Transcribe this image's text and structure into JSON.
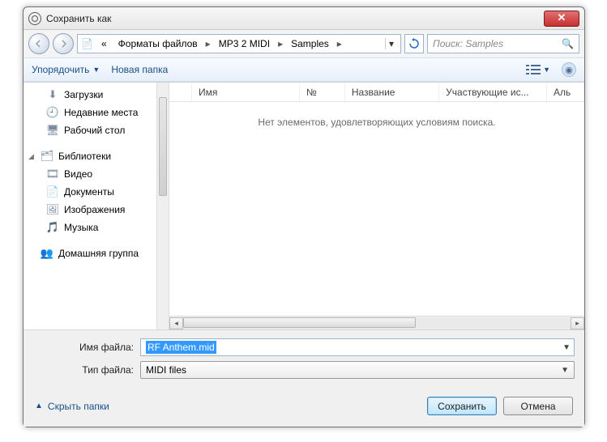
{
  "title": "Сохранить как",
  "close_glyph": "✕",
  "breadcrumb": {
    "prefix": "«",
    "segments": [
      "Форматы файлов",
      "MP3 2 MIDI",
      "Samples"
    ]
  },
  "search": {
    "placeholder": "Поиск: Samples"
  },
  "toolbar": {
    "organize": "Упорядочить",
    "new_folder": "Новая папка"
  },
  "sidebar": {
    "favorites": {
      "items": [
        "Загрузки",
        "Недавние места",
        "Рабочий стол"
      ]
    },
    "libraries": {
      "label": "Библиотеки",
      "items": [
        "Видео",
        "Документы",
        "Изображения",
        "Музыка"
      ]
    },
    "homegroup": {
      "label": "Домашняя группа"
    }
  },
  "columns": {
    "name": "Имя",
    "num": "№",
    "title_col": "Название",
    "artists": "Участвующие ис...",
    "album": "Аль"
  },
  "empty_message": "Нет элементов, удовлетворяющих условиям поиска.",
  "form": {
    "filename_label": "Имя файла:",
    "filename_value": "RF Anthem.mid",
    "filetype_label": "Тип файла:",
    "filetype_value": "MIDI files"
  },
  "footer": {
    "hide_folders": "Скрыть папки",
    "save": "Сохранить",
    "cancel": "Отмена"
  }
}
